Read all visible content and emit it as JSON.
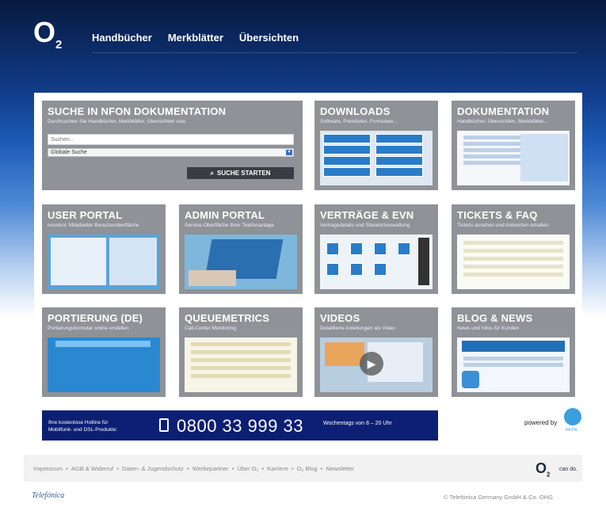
{
  "logo": {
    "o": "O",
    "sub": "2"
  },
  "nav": [
    "Handbücher",
    "Merkblätter",
    "Übersichten"
  ],
  "search": {
    "title": "SUCHE IN NFON DOKUMENTATION",
    "subtitle": "Durchsuchen Sie Handbücher, Merkblätter, Übersichten usw.",
    "placeholder": "Suchen...",
    "select_value": "Globale Suche",
    "button_label": "SUCHE STARTEN"
  },
  "tiles": [
    {
      "title": "DOWNLOADS",
      "subtitle": "Software, Preislisten, Formulare..."
    },
    {
      "title": "DOKUMENTATION",
      "subtitle": "Handbücher, Übersichten, Merkblätter..."
    },
    {
      "title": "USER PORTAL",
      "subtitle": "ncontrol: Mitarbeiter Benutzeroberfläche"
    },
    {
      "title": "ADMIN PORTAL",
      "subtitle": "Service-Oberfläche Ihrer Telefonanlage"
    },
    {
      "title": "VERTRÄGE & EVN",
      "subtitle": "Vertragsdetails und Standortverwaltung"
    },
    {
      "title": "TICKETS & FAQ",
      "subtitle": "Tickets ansehen und Antworten erhalten"
    },
    {
      "title": "PORTIERUNG (DE)",
      "subtitle": "Portierungsformular online erstellen"
    },
    {
      "title": "QUEUEMETRICS",
      "subtitle": "Call-Center Monitoring"
    },
    {
      "title": "VIDEOS",
      "subtitle": "Detaillierte Anleitungen als Video"
    },
    {
      "title": "BLOG & NEWS",
      "subtitle": "News und Infos für Kunden"
    }
  ],
  "hotline": {
    "text_line1": "Ihre kostenlose Hotline für",
    "text_line2": "Mobilfunk- und DSL-Produkte:",
    "number": "0800 33 999 33",
    "hours": "Wochentags von 8 – 20 Uhr"
  },
  "powered_by": "powered by",
  "nfon": "NFON",
  "footer": {
    "links": [
      "Impressum",
      "AGB & Widerruf",
      "Daten- & Jugendschutz",
      "Werbepartner",
      "Über O₂",
      "Karriere",
      "O₂ Blog",
      "Newsletter"
    ],
    "cando": "can do."
  },
  "telefonica": "Telefónica",
  "copyright": "© Telefónica Germany GmbH & Co. OHG",
  "colors": {
    "brand_dark": "#0c1f73",
    "tile_gray": "#8f9296",
    "accent_blue": "#1e5fa8"
  }
}
